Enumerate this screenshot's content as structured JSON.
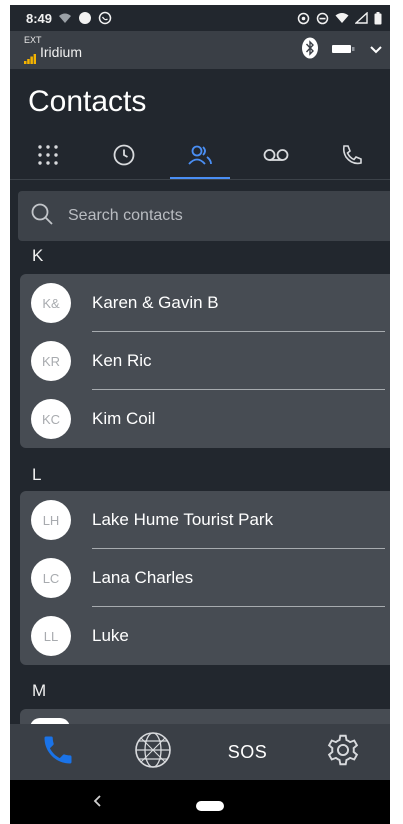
{
  "status_bar": {
    "time": "8:49"
  },
  "ext_bar": {
    "label": "EXT",
    "network": "Iridium"
  },
  "header": {
    "title": "Contacts"
  },
  "tabs": [
    {
      "icon": "dialpad-icon",
      "active": false
    },
    {
      "icon": "clock-icon",
      "active": false
    },
    {
      "icon": "contacts-icon",
      "active": true
    },
    {
      "icon": "voicemail-icon",
      "active": false
    },
    {
      "icon": "phone-call-icon",
      "active": false
    }
  ],
  "search": {
    "placeholder": "Search contacts"
  },
  "sections": [
    {
      "letter": "K",
      "contacts": [
        {
          "initials": "K&",
          "name": "Karen & Gavin B"
        },
        {
          "initials": "KR",
          "name": "Ken Ric"
        },
        {
          "initials": "KC",
          "name": "Kim Coil"
        }
      ]
    },
    {
      "letter": "L",
      "contacts": [
        {
          "initials": "LH",
          "name": "Lake Hume Tourist Park"
        },
        {
          "initials": "LC",
          "name": "Lana Charles"
        },
        {
          "initials": "LL",
          "name": "Luke"
        }
      ]
    },
    {
      "letter": "M",
      "contacts": []
    }
  ],
  "bottom_nav": {
    "sos_label": "SOS"
  },
  "colors": {
    "accent": "#1a73e8",
    "tab_accent": "#4a8ff5",
    "background": "#22272e",
    "card": "#474c53"
  }
}
